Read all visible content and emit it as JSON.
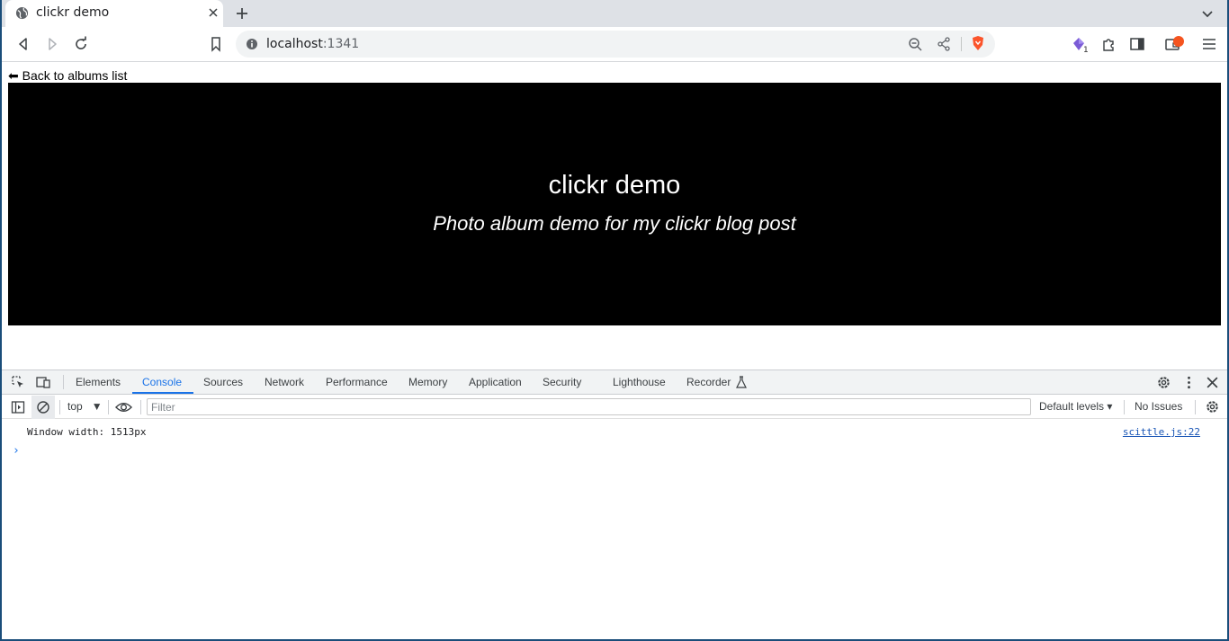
{
  "browser": {
    "tab_title": "clickr demo",
    "url_host": "localhost",
    "url_port": ":1341",
    "extension_badge": "1"
  },
  "page": {
    "back_link": "⬅ Back to albums list",
    "hero_title": "clickr demo",
    "hero_subtitle": "Photo album demo for my clickr blog post"
  },
  "devtools": {
    "tabs": [
      "Elements",
      "Console",
      "Sources",
      "Network",
      "Performance",
      "Memory",
      "Application",
      "Security",
      "Lighthouse",
      "Recorder"
    ],
    "active_tab": "Console",
    "context": "top",
    "filter_placeholder": "Filter",
    "levels": "Default levels",
    "issues": "No Issues",
    "messages": [
      {
        "text": "Window width: 1513px",
        "source": "scittle.js:22"
      }
    ]
  },
  "colors": {
    "accent": "#1a73e8",
    "brave": "#fb542b",
    "hero_bg": "#000000"
  }
}
